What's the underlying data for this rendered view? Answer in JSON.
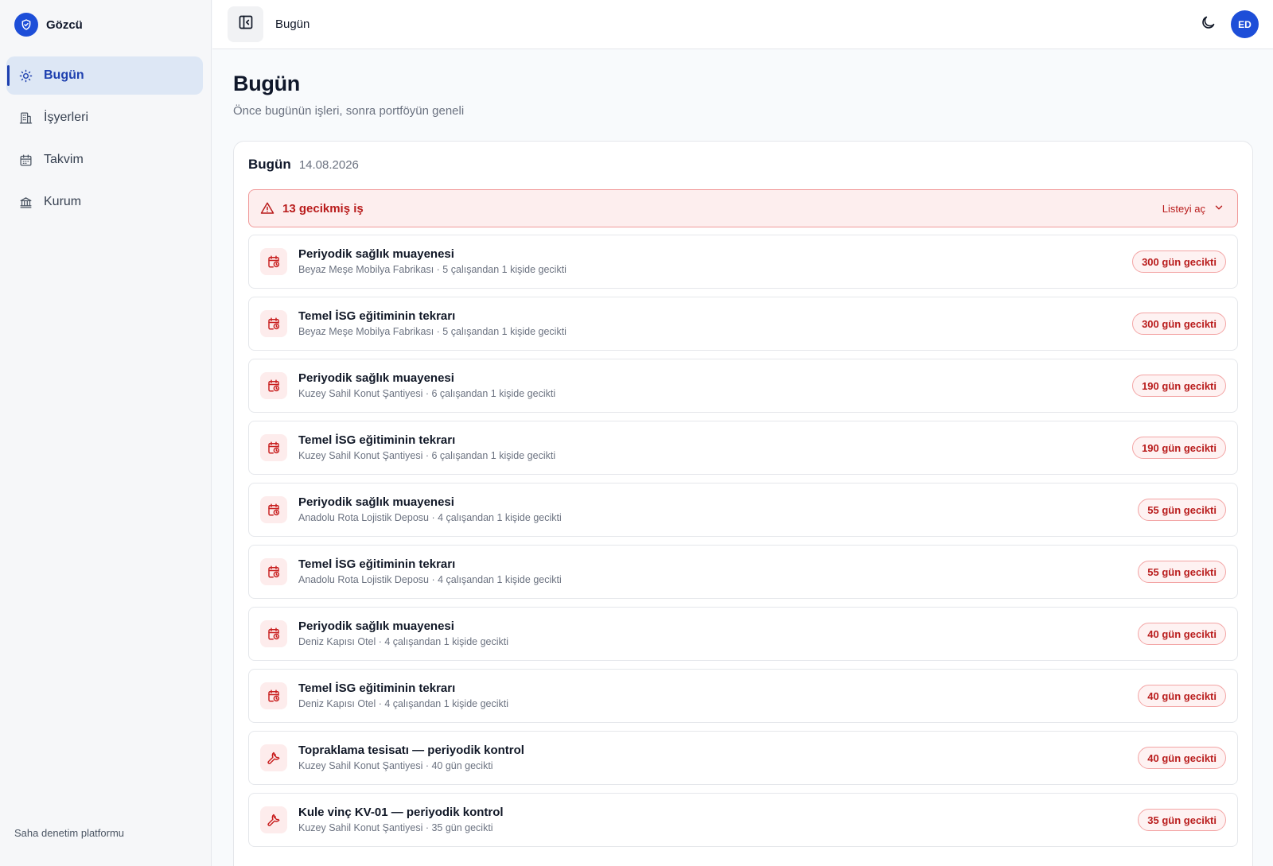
{
  "app": {
    "name": "Gözcü",
    "footer": "Saha denetim platformu"
  },
  "sidebar": {
    "items": [
      {
        "label": "Bugün",
        "icon": "sun-icon",
        "active": true
      },
      {
        "label": "İşyerleri",
        "icon": "building-icon",
        "active": false
      },
      {
        "label": "Takvim",
        "icon": "calendar-icon",
        "active": false
      },
      {
        "label": "Kurum",
        "icon": "institution-icon",
        "active": false
      }
    ]
  },
  "topbar": {
    "title": "Bugün",
    "user_initials": "ED"
  },
  "page": {
    "title": "Bugün",
    "subtitle": "Önce bugünün işleri, sonra portföyün geneli"
  },
  "today_card": {
    "title": "Bugün",
    "date": "14.08.2026",
    "alert": {
      "text": "13 gecikmiş iş",
      "action": "Listeyi aç"
    },
    "tasks": [
      {
        "title": "Periyodik sağlık muayenesi",
        "subtitle": "Beyaz Meşe Mobilya Fabrikası · 5 çalışandan 1 kişide gecikti",
        "badge": "300 gün gecikti",
        "icon": "calendar-clock-icon"
      },
      {
        "title": "Temel İSG eğitiminin tekrarı",
        "subtitle": "Beyaz Meşe Mobilya Fabrikası · 5 çalışandan 1 kişide gecikti",
        "badge": "300 gün gecikti",
        "icon": "calendar-clock-icon"
      },
      {
        "title": "Periyodik sağlık muayenesi",
        "subtitle": "Kuzey Sahil Konut Şantiyesi · 6 çalışandan 1 kişide gecikti",
        "badge": "190 gün gecikti",
        "icon": "calendar-clock-icon"
      },
      {
        "title": "Temel İSG eğitiminin tekrarı",
        "subtitle": "Kuzey Sahil Konut Şantiyesi · 6 çalışandan 1 kişide gecikti",
        "badge": "190 gün gecikti",
        "icon": "calendar-clock-icon"
      },
      {
        "title": "Periyodik sağlık muayenesi",
        "subtitle": "Anadolu Rota Lojistik Deposu · 4 çalışandan 1 kişide gecikti",
        "badge": "55 gün gecikti",
        "icon": "calendar-clock-icon"
      },
      {
        "title": "Temel İSG eğitiminin tekrarı",
        "subtitle": "Anadolu Rota Lojistik Deposu · 4 çalışandan 1 kişide gecikti",
        "badge": "55 gün gecikti",
        "icon": "calendar-clock-icon"
      },
      {
        "title": "Periyodik sağlık muayenesi",
        "subtitle": "Deniz Kapısı Otel · 4 çalışandan 1 kişide gecikti",
        "badge": "40 gün gecikti",
        "icon": "calendar-clock-icon"
      },
      {
        "title": "Temel İSG eğitiminin tekrarı",
        "subtitle": "Deniz Kapısı Otel · 4 çalışandan 1 kişide gecikti",
        "badge": "40 gün gecikti",
        "icon": "calendar-clock-icon"
      },
      {
        "title": "Topraklama tesisatı — periyodik kontrol",
        "subtitle": "Kuzey Sahil Konut Şantiyesi · 40 gün gecikti",
        "badge": "40 gün gecikti",
        "icon": "wrench-icon"
      },
      {
        "title": "Kule vinç KV-01 — periyodik kontrol",
        "subtitle": "Kuzey Sahil Konut Şantiyesi · 35 gün gecikti",
        "badge": "35 gün gecikti",
        "icon": "wrench-icon"
      }
    ]
  },
  "colors": {
    "accent": "#1d4ed8",
    "danger": "#b91c1c",
    "danger_bg": "#fdeeee"
  }
}
